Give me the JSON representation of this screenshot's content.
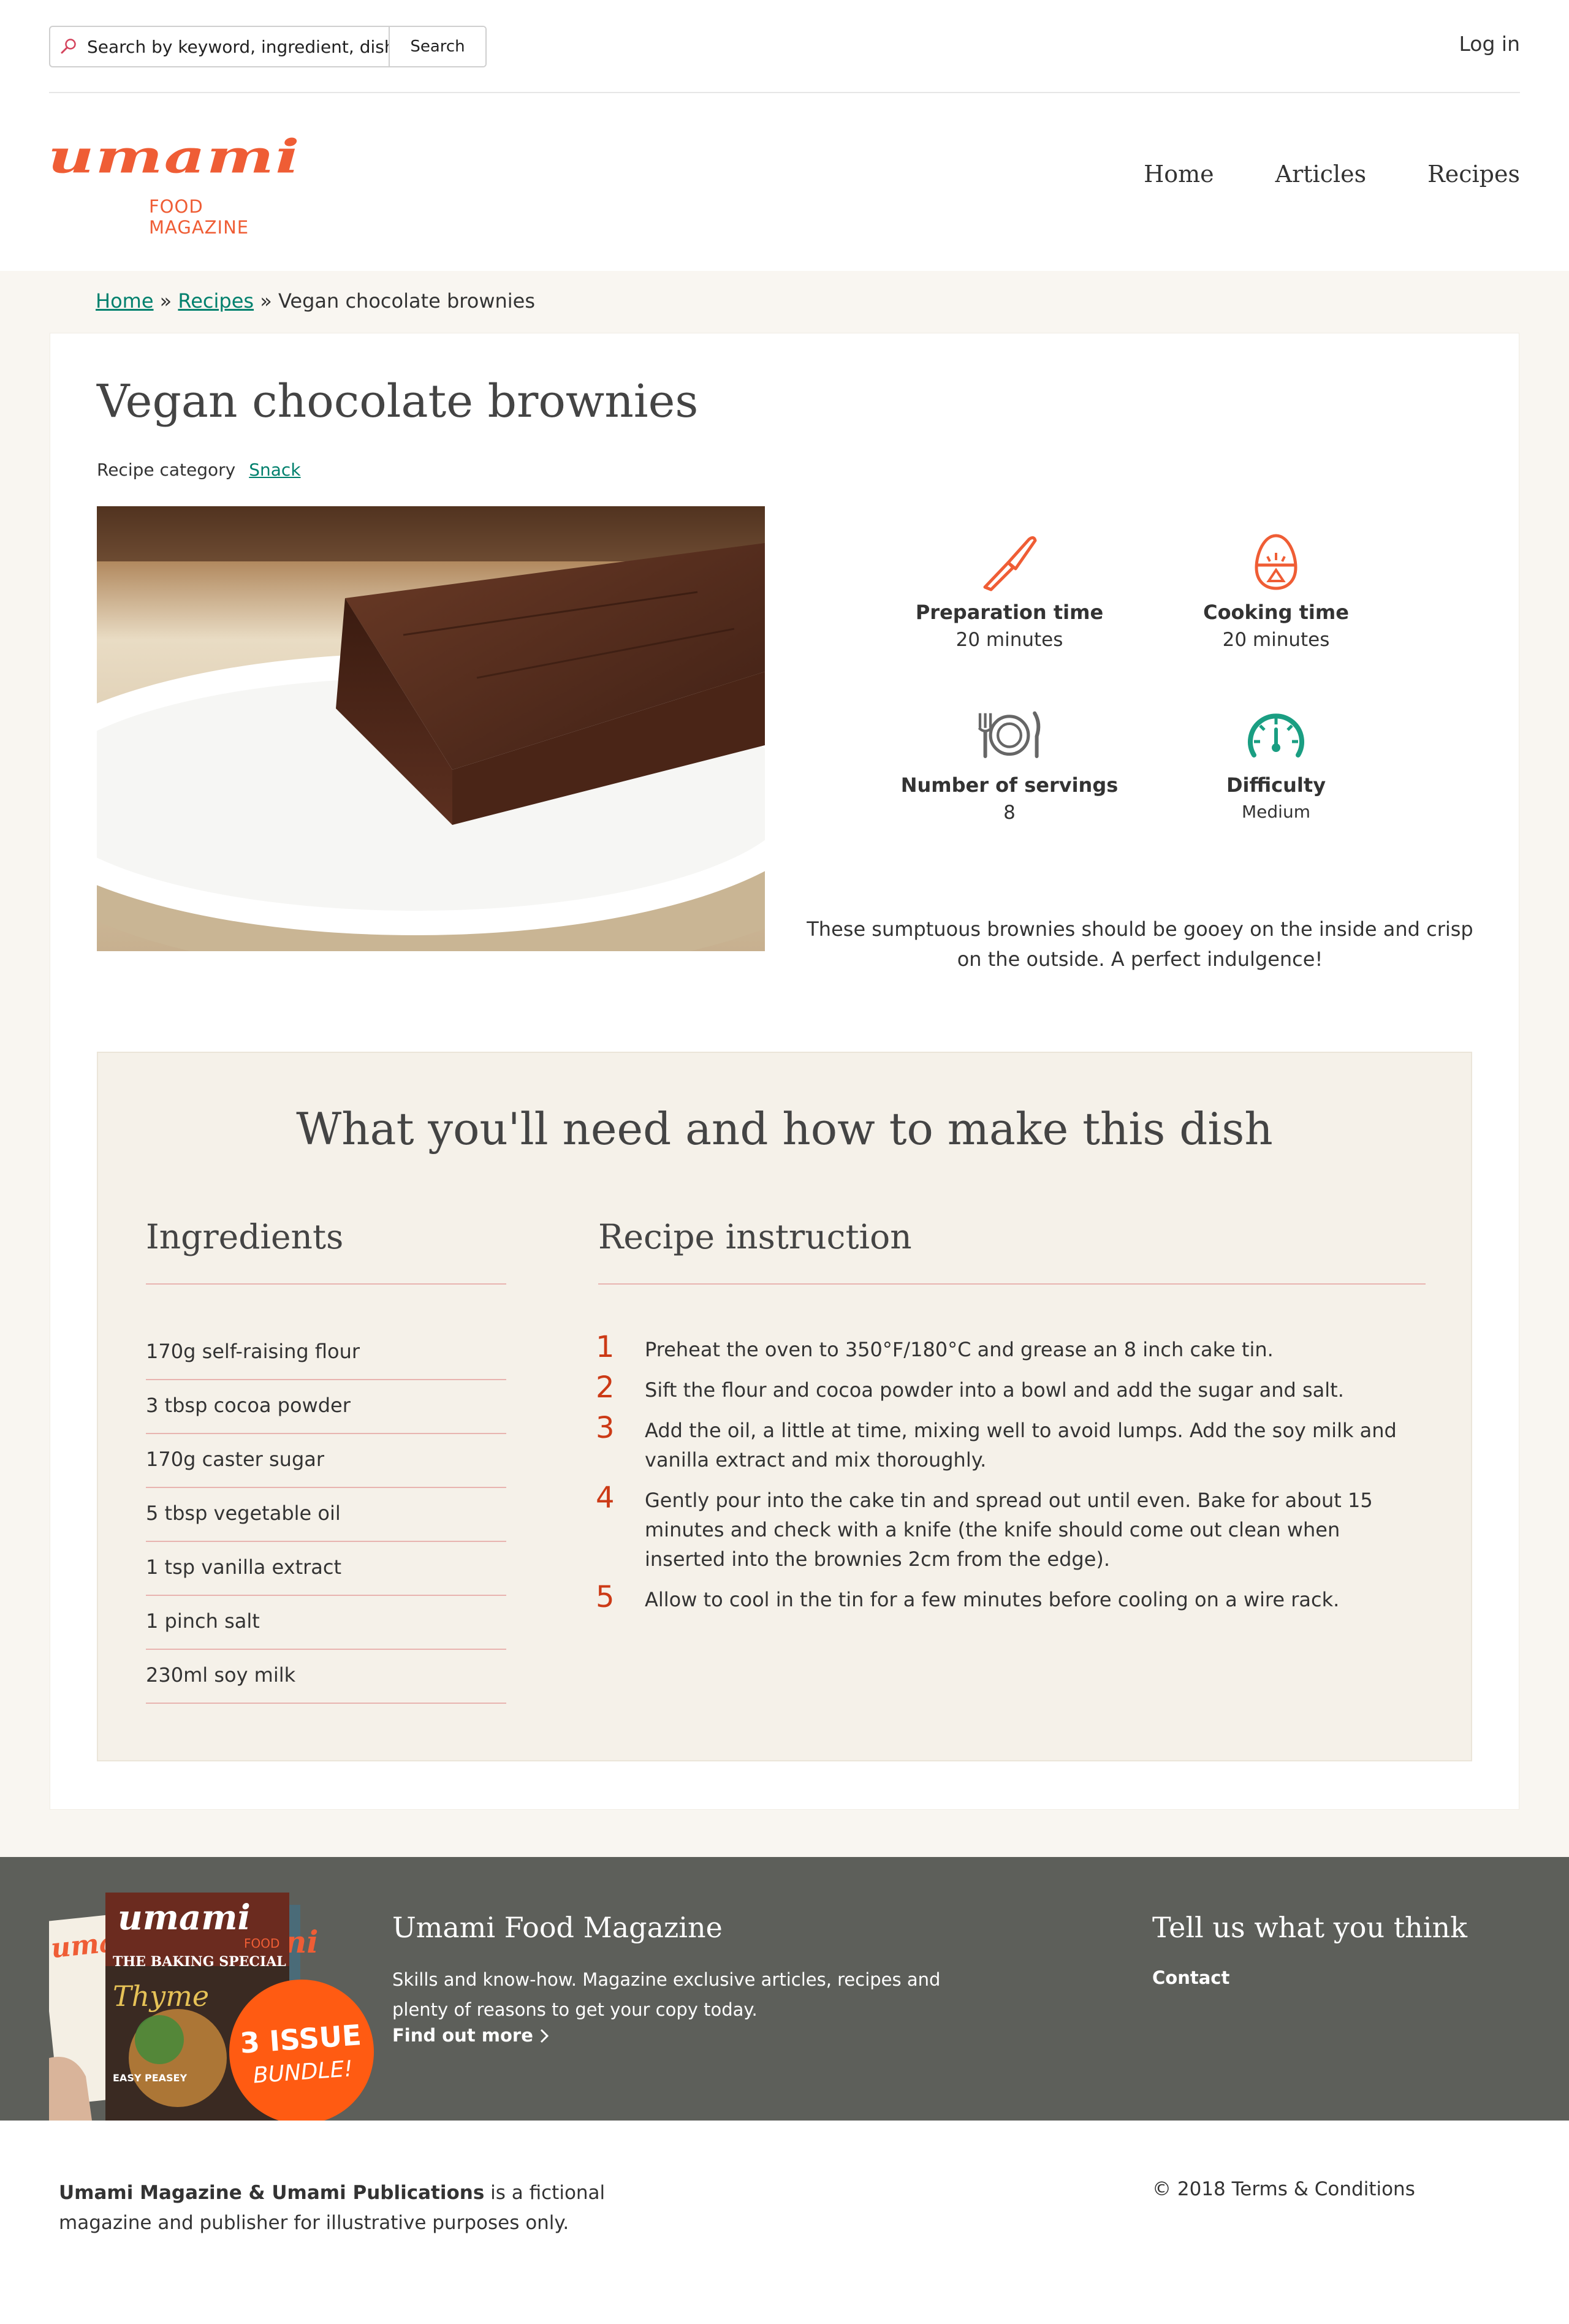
{
  "search": {
    "placeholder": "Search by keyword, ingredient, dish",
    "button_label": "Search"
  },
  "header": {
    "login_label": "Log in"
  },
  "logo": {
    "word": "umami",
    "subtitle": "FOOD MAGAZINE"
  },
  "nav": {
    "items": [
      "Home",
      "Articles",
      "Recipes"
    ]
  },
  "breadcrumb": {
    "home": "Home",
    "separator": " » ",
    "recipes": "Recipes",
    "current": "Vegan chocolate brownies"
  },
  "recipe": {
    "title": "Vegan chocolate brownies",
    "category_label": "Recipe category",
    "category_value": "Snack",
    "description": "These sumptuous brownies should be gooey on the inside and crisp on the outside. A perfect indulgence!"
  },
  "stats": {
    "prep": {
      "label": "Preparation time",
      "value": "20 minutes",
      "icon": "knife-icon"
    },
    "cook": {
      "label": "Cooking time",
      "value": "20 minutes",
      "icon": "egg-timer-icon"
    },
    "servings": {
      "label": "Number of servings",
      "value": "8",
      "icon": "plate-cutlery-icon"
    },
    "difficulty": {
      "label": "Difficulty",
      "value": "Medium",
      "icon": "gauge-icon"
    }
  },
  "recipe_box": {
    "title": "What you'll need and how to make this dish",
    "ingredients_heading": "Ingredients",
    "instructions_heading": "Recipe instruction",
    "ingredients": [
      "170g self-raising flour",
      "3 tbsp cocoa powder",
      "170g caster sugar",
      "5 tbsp vegetable oil",
      "1 tsp vanilla extract",
      "1 pinch salt",
      "230ml soy milk"
    ],
    "steps": [
      {
        "num": "1",
        "text": "Preheat the oven to 350°F/180°C and grease an 8 inch cake tin."
      },
      {
        "num": "2",
        "text": "Sift the flour and cocoa powder into a bowl and add the sugar and salt."
      },
      {
        "num": "3",
        "text": "Add the oil, a little at time, mixing well to avoid lumps. Add the soy milk and vanilla extract and mix thoroughly."
      },
      {
        "num": "4",
        "text": "Gently pour into the cake tin and spread out until even. Bake for about 15 minutes and check with a knife (the knife should come out clean when inserted into the brownies 2cm from the edge)."
      },
      {
        "num": "5",
        "text": "Allow to cool in the tin for a few minutes before cooling on a wire rack."
      }
    ]
  },
  "footer": {
    "magazine_title": "Umami Food Magazine",
    "magazine_text": "Skills and know-how. Magazine exclusive articles, recipes and plenty of reasons to get your copy today.",
    "find_out_more": "Find out more",
    "feedback_title": "Tell us what you think",
    "contact": "Contact",
    "promo": {
      "cover_word": "umami",
      "cover_word_back": "ni",
      "cover_food": "FOOD",
      "cover_baking": "THE BAKING SPECIAL",
      "cover_herb": "Thyme",
      "cover_easy": "EASY PEASEY",
      "bundle_line1": "3 ISSUE",
      "bundle_line2": "BUNDLE!"
    }
  },
  "subfooter": {
    "brand": "Umami Magazine & Umami Publications",
    "text": " is a fictional magazine and publisher for illustrative purposes only.",
    "copyright": "© 2018 Terms & Conditions"
  },
  "colors": {
    "brand": "#ef5d35",
    "link": "#00806d",
    "step_number": "#cc3a16",
    "footer_bg": "#5d5f5a",
    "band_bg": "#f9f6f1",
    "box_bg": "#f5f1e9",
    "gauge": "#1a9e82"
  }
}
